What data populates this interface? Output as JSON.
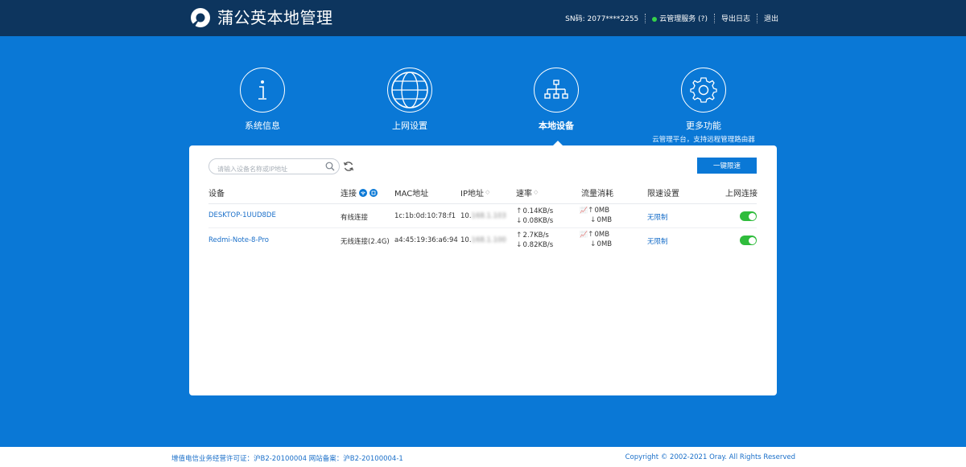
{
  "header": {
    "title": "蒲公英本地管理",
    "sn": "SN码: 2077****2255",
    "cloud_service": "云管理服务 (?)",
    "export_log": "导出日志",
    "logout": "退出"
  },
  "nav": {
    "items": [
      {
        "label": "系统信息",
        "icon": "info-icon"
      },
      {
        "label": "上网设置",
        "icon": "globe-icon"
      },
      {
        "label": "本地设备",
        "icon": "network-icon"
      },
      {
        "label": "更多功能",
        "icon": "gear-icon",
        "sub": "云管理平台，支持远程管理路由器"
      }
    ],
    "active": "本地设备"
  },
  "toolbar": {
    "search_placeholder": "请输入设备名称或IP地址",
    "limit_button": "一键限速"
  },
  "table": {
    "headers": {
      "device": "设备",
      "connection": "连接",
      "mac": "MAC地址",
      "ip": "IP地址",
      "speed": "速率",
      "traffic": "流量消耗",
      "limit": "限速设置",
      "internet": "上网连接"
    },
    "rows": [
      {
        "device": "DESKTOP-1UUD8DE",
        "connection": "有线连接",
        "mac": "1c:1b:0d:10:78:f1",
        "ip_prefix": "10.",
        "ip_hidden": "168.1.103",
        "speed_up": "0.14KB/s",
        "speed_down": "0.08KB/s",
        "traffic_up": "0MB",
        "traffic_down": "0MB",
        "limit": "无限制",
        "online": true
      },
      {
        "device": "Redmi-Note-8-Pro",
        "connection": "无线连接(2.4G)",
        "mac": "a4:45:19:36:a6:94",
        "ip_prefix": "10.",
        "ip_hidden": "168.1.100",
        "speed_up": "2.7KB/s",
        "speed_down": "0.82KB/s",
        "traffic_up": "0MB",
        "traffic_down": "0MB",
        "limit": "无限制",
        "online": true
      }
    ]
  },
  "footer": {
    "license": "增值电信业务经营许可证：沪B2-20100004 网站备案：沪B2-20100004-1",
    "copyright": "Copyright © 2002-2021 Oray. All Rights Reserved"
  },
  "colors": {
    "primary": "#0a78d6",
    "header_bg": "#0d355e",
    "toggle_on": "#2fbc3c",
    "link": "#1a6fc9"
  }
}
